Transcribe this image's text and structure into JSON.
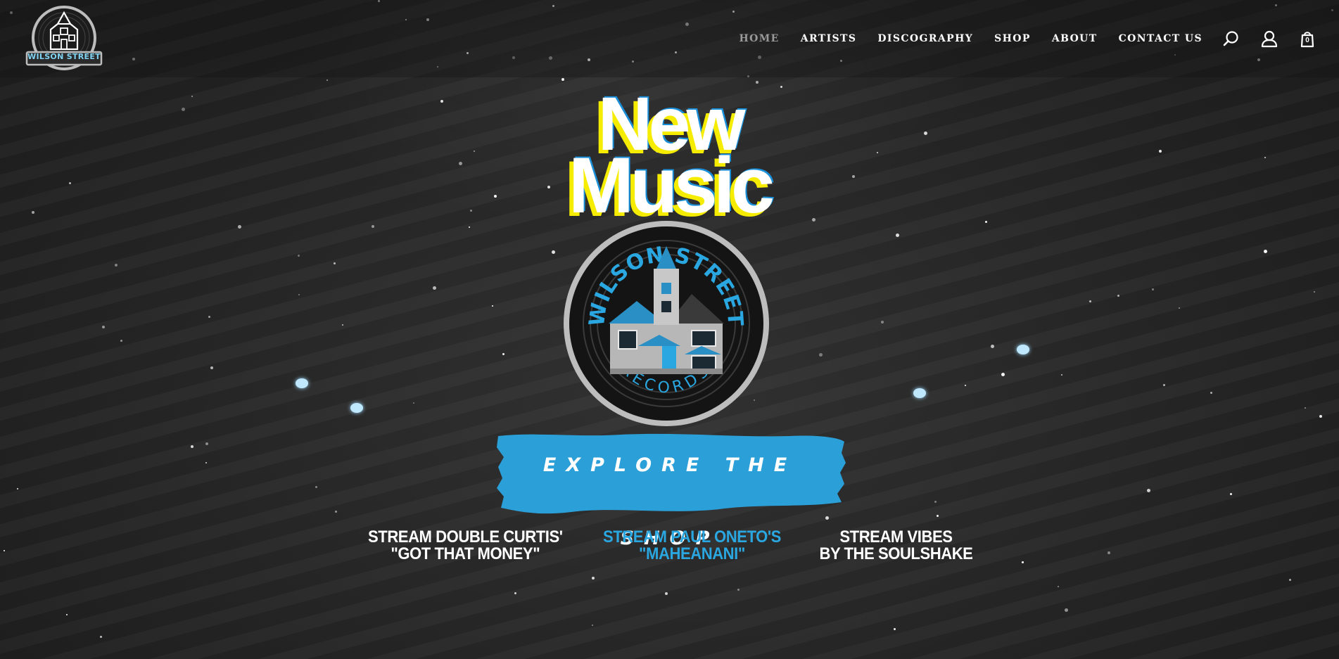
{
  "brand": {
    "logo_text": "WILSON STREET",
    "logo_subtext": "RECORDS",
    "accent_color": "#2aa7e1",
    "headline_shadow_color": "#f5ec00"
  },
  "nav": {
    "items": [
      {
        "label": "HOME",
        "active": true
      },
      {
        "label": "ARTISTS"
      },
      {
        "label": "DISCOGRAPHY"
      },
      {
        "label": "SHOP"
      },
      {
        "label": "ABOUT"
      },
      {
        "label": "CONTACT US"
      }
    ],
    "icons": [
      "search-icon",
      "account-icon",
      "cart-icon"
    ],
    "cart_count": "0"
  },
  "hero": {
    "headline_line1": "New",
    "headline_line2": "Music",
    "badge_top_text": "WILSON STREET",
    "badge_bottom_text": "RECORDS",
    "cta_label": "EXPLORE THE SHOP"
  },
  "streams": [
    {
      "line1": "STREAM DOUBLE CURTIS'",
      "line2": "\"GOT THAT MONEY\"",
      "color": "#ffffff"
    },
    {
      "line1": "STREAM PAUL ONETO'S",
      "line2": "\"MAHEANANI\"",
      "color": "#2aa7e1"
    },
    {
      "line1": "STREAM VIBES",
      "line2": "BY THE SOULSHAKE",
      "color": "#ffffff"
    }
  ]
}
